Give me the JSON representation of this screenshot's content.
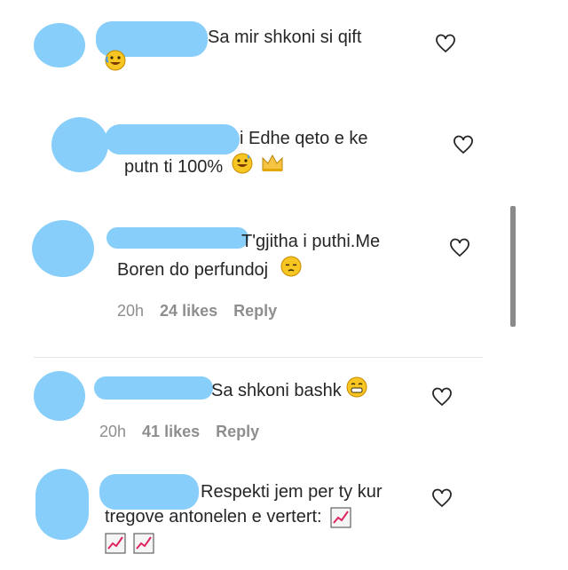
{
  "comments": [
    {
      "text_line1": "Sa mir shkoni si qift",
      "emoji_line2": "rofl-emoji"
    },
    {
      "text_line1": "i Edhe qeto e ke",
      "text_line2": "putn ti 100%",
      "emojis": [
        "sweat-smile-emoji",
        "crown-emoji"
      ]
    },
    {
      "text_line1": "T'gjitha i puthi.Me",
      "text_line2": "Boren do perfundoj",
      "emoji": "pensive-emoji",
      "time": "20h",
      "likes": "24 likes",
      "reply": "Reply"
    },
    {
      "text_line1": "Sa shkoni bashk",
      "emoji": "grin-emoji",
      "time": "20h",
      "likes": "41 likes",
      "reply": "Reply"
    },
    {
      "text_line1": "Respekti jem per ty kur",
      "text_line2": "tregove antonelen e vertert:",
      "emojis": [
        "chart-increasing-emoji",
        "chart-increasing-emoji",
        "chart-increasing-emoji"
      ]
    }
  ]
}
